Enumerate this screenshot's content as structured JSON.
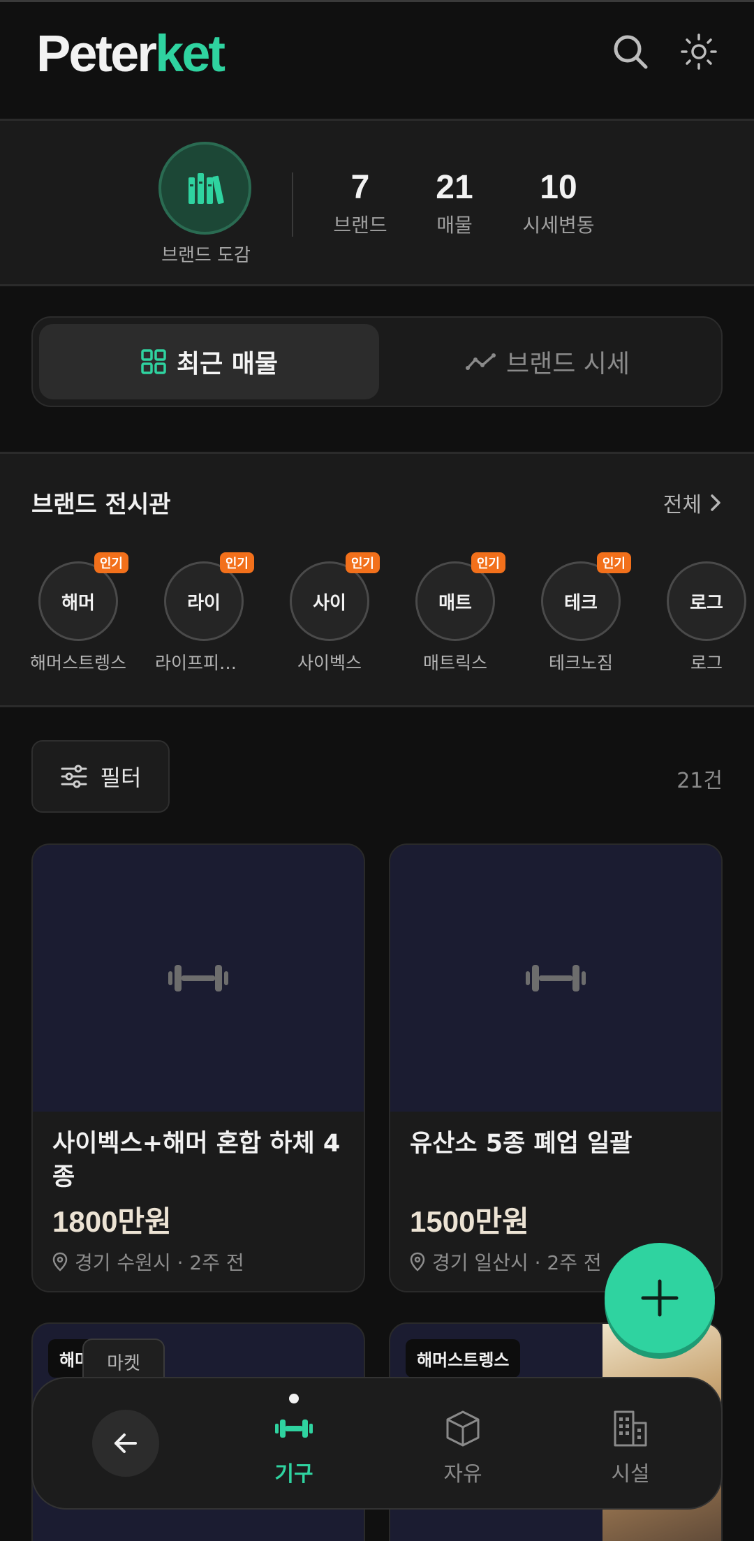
{
  "header": {
    "logo_part1": "Peter",
    "logo_part2": "ket"
  },
  "stats": {
    "brand_book_label": "브랜드 도감",
    "items": [
      {
        "value": "7",
        "label": "브랜드"
      },
      {
        "value": "21",
        "label": "매물"
      },
      {
        "value": "10",
        "label": "시세변동"
      }
    ]
  },
  "tabs": {
    "recent": "최근 매물",
    "price": "브랜드 시세"
  },
  "brands": {
    "title": "브랜드 전시관",
    "all_label": "전체",
    "badge": "인기",
    "items": [
      {
        "short": "해머",
        "name": "해머스트렝스",
        "popular": true
      },
      {
        "short": "라이",
        "name": "라이프피트니스",
        "popular": true
      },
      {
        "short": "사이",
        "name": "사이벡스",
        "popular": true
      },
      {
        "short": "매트",
        "name": "매트릭스",
        "popular": true
      },
      {
        "short": "테크",
        "name": "테크노짐",
        "popular": true
      },
      {
        "short": "로그",
        "name": "로그",
        "popular": false
      }
    ]
  },
  "listing": {
    "filter_label": "필터",
    "count": "21건",
    "cards": [
      {
        "title": "사이벡스+해머 혼합 하체 4종",
        "price": "1800만원",
        "location": "경기 수원시",
        "time": "2주 전",
        "meta": "경기 수원시 · 2주 전"
      },
      {
        "title": "유산소 5종 폐업 일괄",
        "price": "1500만원",
        "location": "경기 일산시",
        "time": "2주 전",
        "meta": "경기 일산시 · 2주 전"
      }
    ],
    "partial_cards": [
      {
        "tag": "해머스트렝스"
      },
      {
        "tag": "해머스트렝스"
      }
    ]
  },
  "bottom_nav": {
    "market_tab": "마켓",
    "items": [
      {
        "label": "기구",
        "icon": "dumbbell-icon",
        "active": true
      },
      {
        "label": "자유",
        "icon": "box-icon",
        "active": false
      },
      {
        "label": "시설",
        "icon": "building-icon",
        "active": false
      }
    ]
  },
  "colors": {
    "accent": "#2fd3a0",
    "badge": "#f2701b",
    "background": "#101010",
    "surface": "#1b1b1b"
  }
}
